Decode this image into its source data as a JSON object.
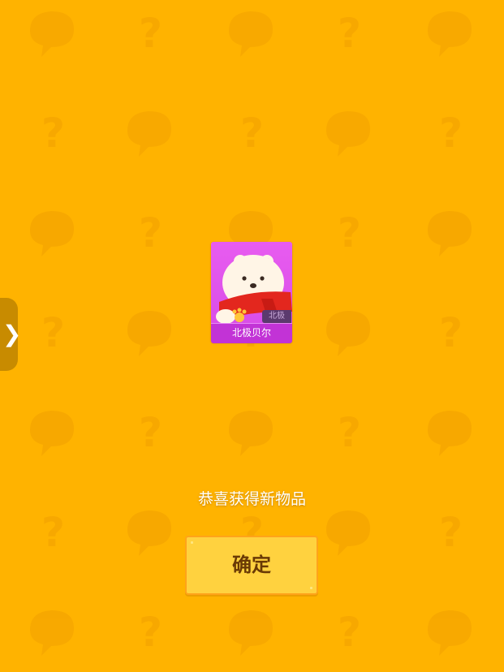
{
  "colors": {
    "background": "#FFB300",
    "card": "#E85CF0",
    "button": "#FFD23F",
    "button_text": "#6A3A05"
  },
  "side_tab": {
    "icon": "chevron-right-icon",
    "glyph": "❯"
  },
  "reward_item": {
    "name": "北极贝尔",
    "badge": "北极",
    "icon": "polar-bear-icon"
  },
  "message": "恭喜获得新物品",
  "confirm_button": {
    "label": "确定"
  }
}
